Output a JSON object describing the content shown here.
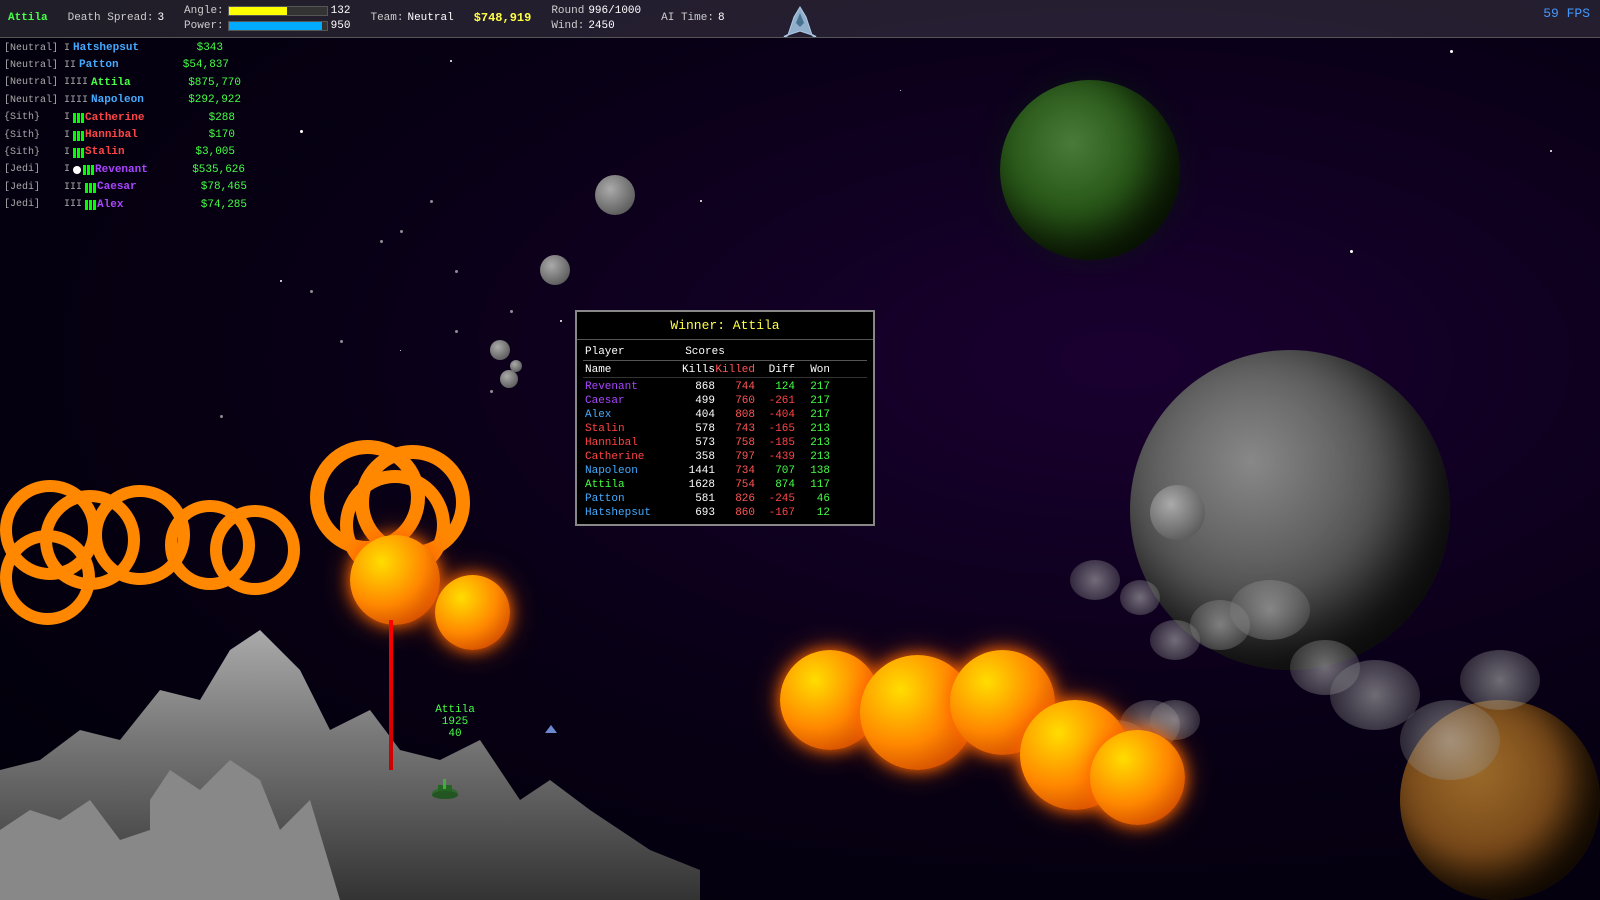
{
  "hud": {
    "player": "Attila",
    "angle_label": "Angle:",
    "angle_value": "132",
    "power_label": "Power:",
    "power_value": "950",
    "team_label": "Team:",
    "team_value": "Neutral",
    "money": "$748,919",
    "round_label": "Round",
    "round_value": "996/1000",
    "wind_label": "Wind:",
    "wind_value": "2450",
    "ai_label": "AI Time:",
    "ai_value": "8",
    "death_spread_label": "Death Spread:",
    "death_spread_value": "3",
    "fps": "59 FPS"
  },
  "players": [
    {
      "team": "[Neutral]",
      "rank": "I",
      "name": "Hatshepsut",
      "score": "$343",
      "name_color": "#44aaff",
      "bars": 0
    },
    {
      "team": "[Neutral]",
      "rank": "II",
      "name": "Patton",
      "score": "$54,837",
      "name_color": "#44aaff",
      "bars": 0
    },
    {
      "team": "[Neutral]",
      "rank": "IIII",
      "name": "Attila",
      "score": "$875,770",
      "name_color": "#44ff44",
      "bars": 0
    },
    {
      "team": "[Neutral]",
      "rank": "IIII",
      "name": "Napoleon",
      "score": "$292,922",
      "name_color": "#44aaff",
      "bars": 0
    },
    {
      "team": "{Sith}",
      "rank": "I",
      "name": "Catherine",
      "score": "$288",
      "name_color": "#ff4444",
      "bars": 3
    },
    {
      "team": "{Sith}",
      "rank": "I",
      "name": "Hannibal",
      "score": "$170",
      "name_color": "#ff4444",
      "bars": 3
    },
    {
      "team": "{Sith}",
      "rank": "I",
      "name": "Stalin",
      "score": "$3,005",
      "name_color": "#ff4444",
      "bars": 3
    },
    {
      "team": "[Jedi]",
      "rank": "I",
      "name": "Revenant",
      "score": "$535,626",
      "name_color": "#aa44ff",
      "bars": 3,
      "dot": true
    },
    {
      "team": "[Jedi]",
      "rank": "III",
      "name": "Caesar",
      "score": "$78,465",
      "name_color": "#aa44ff",
      "bars": 3
    },
    {
      "team": "[Jedi]",
      "rank": "III",
      "name": "Alex",
      "score": "$74,285",
      "name_color": "#aa44ff",
      "bars": 3
    }
  ],
  "score_panel": {
    "title": "Winner: Attila",
    "headers": {
      "player": "Player",
      "scores": "Scores",
      "name": "Name",
      "kills": "Kills",
      "killed": "Killed",
      "diff": "Diff",
      "won": "Won"
    },
    "rows": [
      {
        "name": "Revenant",
        "kills": "868",
        "killed": "744",
        "diff": "124",
        "won": "217",
        "name_color": "#aa44ff",
        "diff_sign": "positive"
      },
      {
        "name": "Caesar",
        "kills": "499",
        "killed": "760",
        "diff": "-261",
        "won": "217",
        "name_color": "#aa44ff",
        "diff_sign": "negative"
      },
      {
        "name": "Alex",
        "kills": "404",
        "killed": "808",
        "diff": "-404",
        "won": "217",
        "name_color": "#44aaff",
        "diff_sign": "negative"
      },
      {
        "name": "Stalin",
        "kills": "578",
        "killed": "743",
        "diff": "-165",
        "won": "213",
        "name_color": "#ff4444",
        "diff_sign": "negative"
      },
      {
        "name": "Hannibal",
        "kills": "573",
        "killed": "758",
        "diff": "-185",
        "won": "213",
        "name_color": "#ff4444",
        "diff_sign": "negative"
      },
      {
        "name": "Catherine",
        "kills": "358",
        "killed": "797",
        "diff": "-439",
        "won": "213",
        "name_color": "#ff4444",
        "diff_sign": "negative"
      },
      {
        "name": "Napoleon",
        "kills": "1441",
        "killed": "734",
        "diff": "707",
        "won": "138",
        "name_color": "#44aaff",
        "diff_sign": "positive"
      },
      {
        "name": "Attila",
        "kills": "1628",
        "killed": "754",
        "diff": "874",
        "won": "117",
        "name_color": "#44ff44",
        "diff_sign": "positive"
      },
      {
        "name": "Patton",
        "kills": "581",
        "killed": "826",
        "diff": "-245",
        "won": "46",
        "name_color": "#44aaff",
        "diff_sign": "negative"
      },
      {
        "name": "Hatshepsut",
        "kills": "693",
        "killed": "860",
        "diff": "-167",
        "won": "12",
        "name_color": "#44aaff",
        "diff_sign": "negative"
      }
    ]
  },
  "attila_label": {
    "name": "Attila",
    "health": "1925",
    "value": "40"
  }
}
